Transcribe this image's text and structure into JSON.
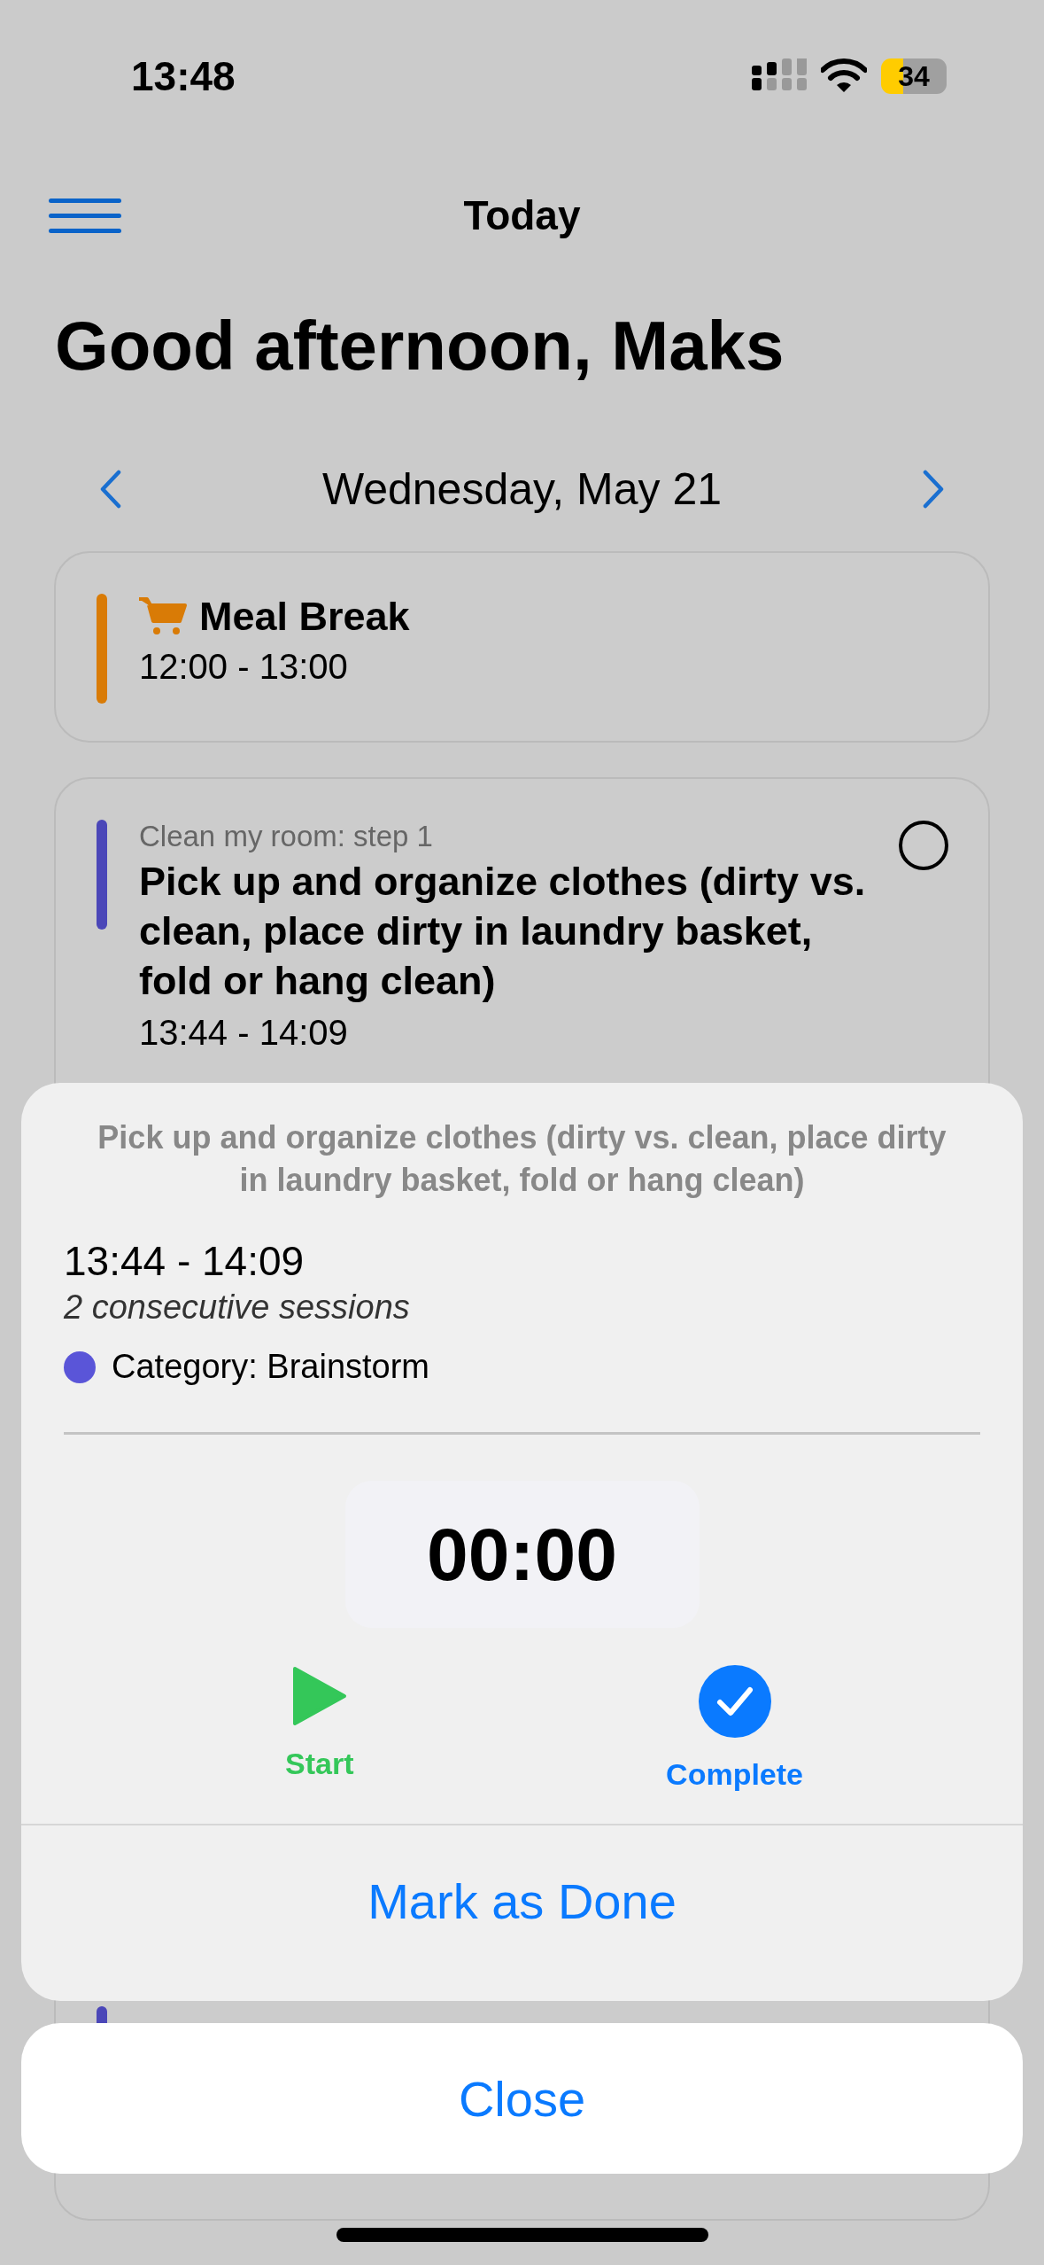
{
  "status_bar": {
    "time": "13:48",
    "battery": "34"
  },
  "header": {
    "title": "Today"
  },
  "greeting": "Good afternoon, Maks",
  "date_nav": {
    "date": "Wednesday, May 21"
  },
  "schedule": [
    {
      "kind": "break",
      "title": "Meal Break",
      "time": "12:00 - 13:00",
      "color": "#d97b06"
    },
    {
      "kind": "task",
      "subtitle": "Clean my room: step 1",
      "title": "Pick up and organize clothes (dirty vs. clean, place dirty in laundry basket, fold or hang clean)",
      "time": "13:44 - 14:09",
      "color": "#4b47b8",
      "checked": false
    },
    {
      "kind": "task",
      "color": "#4b47b8"
    }
  ],
  "sheet": {
    "title": "Pick up and organize clothes (dirty vs. clean, place dirty in laundry basket, fold or hang clean)",
    "time": "13:44 - 14:09",
    "sessions": "2 consecutive sessions",
    "category": {
      "label": "Category: Brainstorm",
      "color": "#5a55d8"
    },
    "timer": "00:00",
    "actions": [
      {
        "kind": "start",
        "label": "Start"
      },
      {
        "kind": "complete",
        "label": "Complete"
      }
    ],
    "primary_action": "Mark as Done"
  },
  "close_button": "Close"
}
